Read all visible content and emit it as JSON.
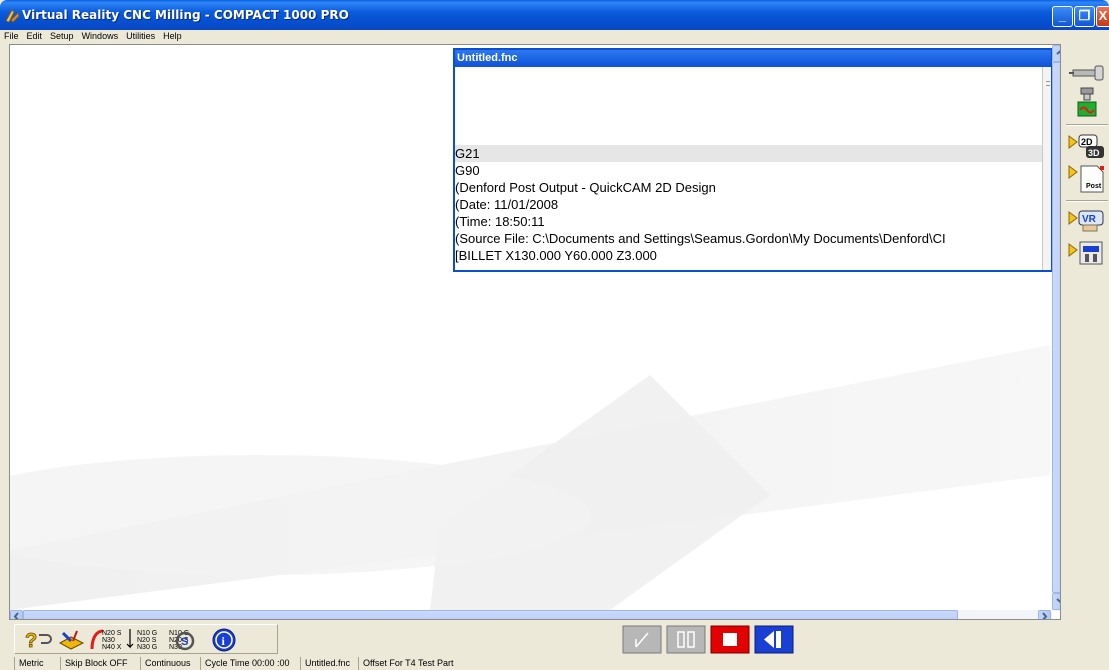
{
  "window": {
    "title": "Virtual Reality CNC Milling  - COMPACT 1000 PRO",
    "controls": {
      "minimize": "_",
      "maximize": "❐",
      "close": "X"
    }
  },
  "menu": [
    "File",
    "Edit",
    "Setup",
    "Windows",
    "Utilities",
    "Help"
  ],
  "editor": {
    "title": "Untitled.fnc",
    "lines": [
      "G21",
      "G90",
      "(Denford Post Output - QuickCAM 2D Design",
      "(Date: 11/01/2008",
      "(Time: 18:50:11",
      "(Source File: C:\\Documents and Settings\\Seamus.Gordon\\My Documents\\Denford\\CI",
      "[BILLET X130.000 Y60.000 Z3.000"
    ]
  },
  "right_toolbar": [
    "machine-tool-icon",
    "tool-change-icon",
    "2d-3d-view-icon",
    "post-icon",
    "vr-view-icon",
    "machine-view-icon"
  ],
  "bottom_toolbar": {
    "left_buttons": [
      "help-pointer-icon",
      "tool-library-icon",
      "renumber-icon",
      "sort-blocks-icon",
      "delete-numbers-icon",
      "info-icon"
    ],
    "renumber_text": [
      "N20 S",
      "N30",
      "N40 X"
    ],
    "sort_text": [
      "N10 G",
      "N20 S",
      "N30 G"
    ],
    "strip_text": [
      "N10 G",
      "N20 S",
      "N30"
    ],
    "info_label": "i"
  },
  "status": [
    "Metric",
    "Skip Block OFF",
    "Continuous",
    "Cycle Time 00:00 :00",
    "Untitled.fnc",
    "Offset For T4 Test Part"
  ],
  "colors": {
    "titlebar": "#0b5bdc",
    "accent": "#0a4fd0",
    "stop": "#e30000",
    "info": "#1a3fd4"
  }
}
